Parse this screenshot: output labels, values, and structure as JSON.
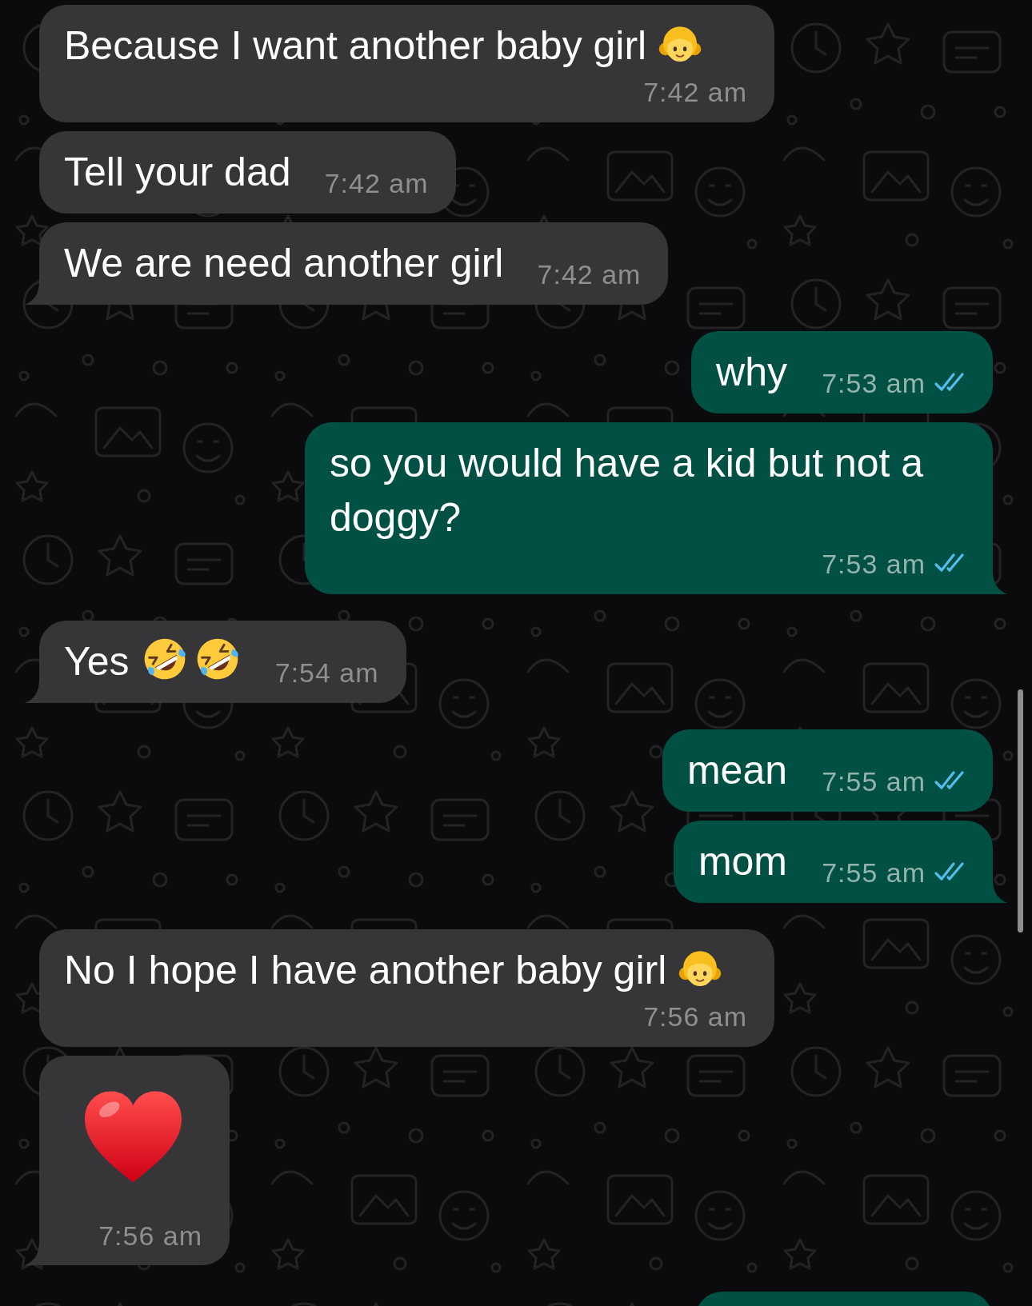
{
  "chat": {
    "messages": [
      {
        "outgoing": false,
        "kind": "text",
        "text": "Because I want another baby girl",
        "emoji": [
          {
            "kind": "girl"
          }
        ],
        "time": "7:42 am"
      },
      {
        "outgoing": false,
        "kind": "text",
        "text": "Tell your dad",
        "time": "7:42 am"
      },
      {
        "outgoing": false,
        "kind": "text",
        "text": "We are need another girl",
        "time": "7:42 am"
      },
      {
        "outgoing": true,
        "kind": "text",
        "text": "why",
        "time": "7:53 am",
        "read": true
      },
      {
        "outgoing": true,
        "kind": "text",
        "text": "so you would have a kid but not a doggy?",
        "time": "7:53 am",
        "read": true
      },
      {
        "outgoing": false,
        "kind": "text",
        "text": "Yes",
        "emoji": [
          {
            "kind": "rofl"
          },
          {
            "kind": "rofl"
          }
        ],
        "time": "7:54 am"
      },
      {
        "outgoing": true,
        "kind": "text",
        "text": "mean",
        "time": "7:55 am",
        "read": true
      },
      {
        "outgoing": true,
        "kind": "text",
        "text": "mom",
        "time": "7:55 am",
        "read": true
      },
      {
        "outgoing": false,
        "kind": "text",
        "text": "No I hope I have another baby girl",
        "emoji": [
          {
            "kind": "girl"
          }
        ],
        "time": "7:56 am"
      },
      {
        "outgoing": false,
        "kind": "jumbo_emoji",
        "emoji": [
          {
            "kind": "heart"
          }
        ],
        "time": "7:56 am"
      },
      {
        "outgoing": true,
        "kind": "cut_off"
      }
    ]
  }
}
